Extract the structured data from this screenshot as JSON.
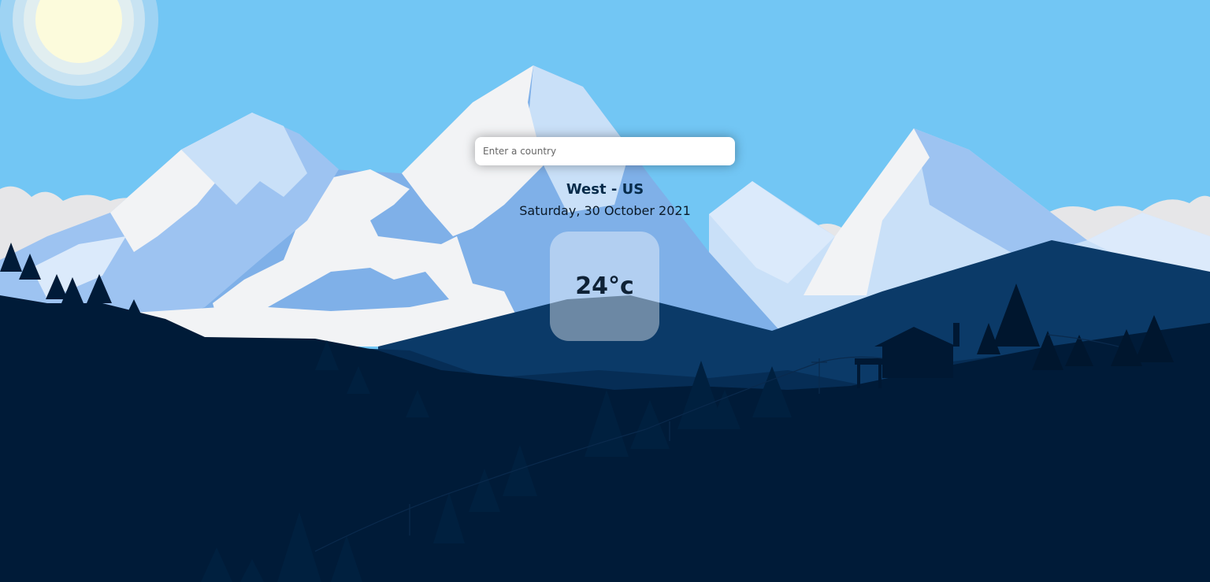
{
  "search": {
    "placeholder": "Enter a country",
    "value": ""
  },
  "weather": {
    "location": "West - US",
    "date": "Saturday, 30 October 2021",
    "temperature": "24°c"
  },
  "colors": {
    "sky": "#72c6f4",
    "sun": "#fdfbdc",
    "snow": "#f1f1f2",
    "mountain_light": "#c9e0f8",
    "mountain_mid": "#7fb0e8",
    "hill_mid": "#0b3a68",
    "forest_dark": "#001b38",
    "text_dark": "#062b4a"
  }
}
